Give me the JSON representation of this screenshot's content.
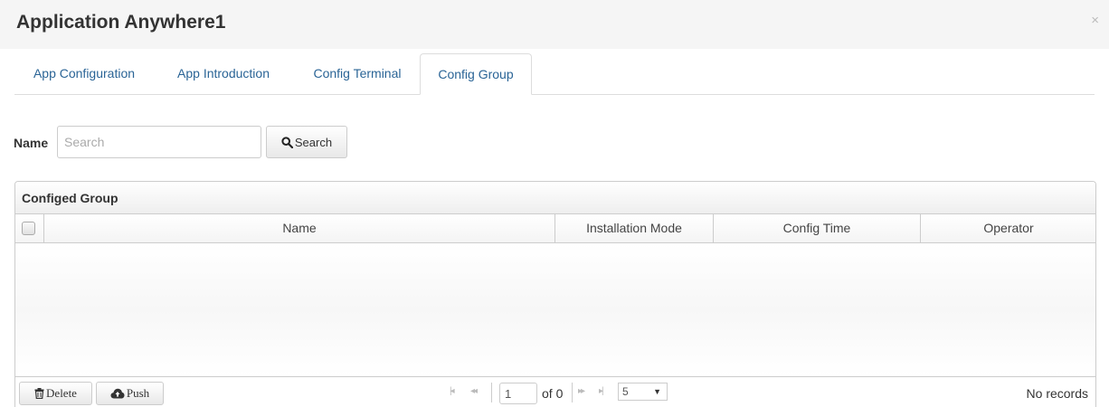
{
  "dialog": {
    "title": "Application Anywhere1",
    "close_symbol": "×"
  },
  "tabs": [
    {
      "label": "App Configuration",
      "active": false
    },
    {
      "label": "App Introduction",
      "active": false
    },
    {
      "label": "Config Terminal",
      "active": false
    },
    {
      "label": "Config Group",
      "active": true
    }
  ],
  "search": {
    "label": "Name",
    "placeholder": "Search",
    "value": "",
    "button_label": "Search",
    "button_icon": "search-icon"
  },
  "grid": {
    "caption": "Configed Group",
    "columns": [
      "Name",
      "Installation Mode",
      "Config Time",
      "Operator"
    ],
    "rows": []
  },
  "pager": {
    "delete_label": "Delete",
    "delete_icon": "trash-icon",
    "push_label": "Push",
    "push_icon": "cloud-upload-icon",
    "first_symbol": "|◂",
    "prev_symbol": "◂◂",
    "next_symbol": "▸▸",
    "last_symbol": "▸|",
    "current_page": "1",
    "of_text": "of 0",
    "rows_per_page": "5",
    "rows_caret": "▼",
    "records_text": "No records"
  },
  "colors": {
    "link": "#2a6496",
    "header_bg": "#f5f5f5",
    "border": "#cccccc"
  }
}
